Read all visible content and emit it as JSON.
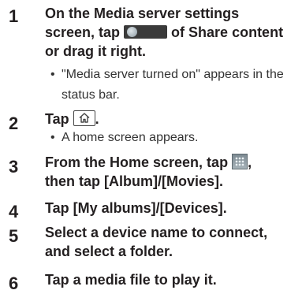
{
  "steps": [
    {
      "number": "1",
      "line1": "On the Media server settings",
      "line2_before": "screen, tap ",
      "line2_after": " of Share content",
      "line3": "or drag it right.",
      "note1": "\"Media server turned on\" appears in the",
      "note2": "status bar."
    },
    {
      "number": "2",
      "line1_before": "Tap ",
      "line1_after": ".",
      "note1": "A home screen appears."
    },
    {
      "number": "3",
      "line1_before": "From the Home screen, tap ",
      "line1_after": ",",
      "line2": "then tap [Album]/[Movies]."
    },
    {
      "number": "4",
      "line1": "Tap [My albums]/[Devices]."
    },
    {
      "number": "5",
      "line1": "Select a device name to connect,",
      "line2": "and select a folder."
    },
    {
      "number": "6",
      "line1": "Tap a media file to play it."
    }
  ],
  "bullet": "•",
  "icons": {
    "share_toggle": "toggle-switch-icon",
    "home_key": "home-key-icon",
    "apps": "apps-grid-icon"
  }
}
